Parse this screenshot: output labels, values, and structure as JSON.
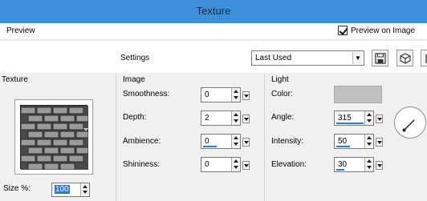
{
  "window": {
    "title": "Texture"
  },
  "preview": {
    "label": "Preview",
    "preview_on_image_label": "Preview on Image",
    "preview_on_image_checked": true
  },
  "settings": {
    "label": "Settings",
    "preset_value": "Last Used"
  },
  "texture": {
    "section_title": "Texture",
    "size_label": "Size %:",
    "size_value": "100"
  },
  "image": {
    "section_title": "Image",
    "fields": [
      {
        "label": "Smoothness:",
        "value": "0",
        "level": 0
      },
      {
        "label": "Depth:",
        "value": "2",
        "level": 0
      },
      {
        "label": "Ambience:",
        "value": "0",
        "level": 0.5
      },
      {
        "label": "Shininess:",
        "value": "0",
        "level": 0
      }
    ]
  },
  "light": {
    "section_title": "Light",
    "color_label": "Color:",
    "color_value": "#c0c0c0",
    "fields": [
      {
        "label": "Angle:",
        "value": "315",
        "level": 1.0
      },
      {
        "label": "Intensity:",
        "value": "50",
        "level": 0.5
      },
      {
        "label": "Elevation:",
        "value": "30",
        "level": 0.3
      }
    ],
    "angle_degrees": 315
  },
  "colors": {
    "titlebar": "#3e8fd9",
    "accent": "#2b7bd6"
  },
  "icons": [
    "save-icon",
    "randomize-icon",
    "reset-icon",
    "checkmark-icon",
    "dropdown-arrow-icon"
  ]
}
